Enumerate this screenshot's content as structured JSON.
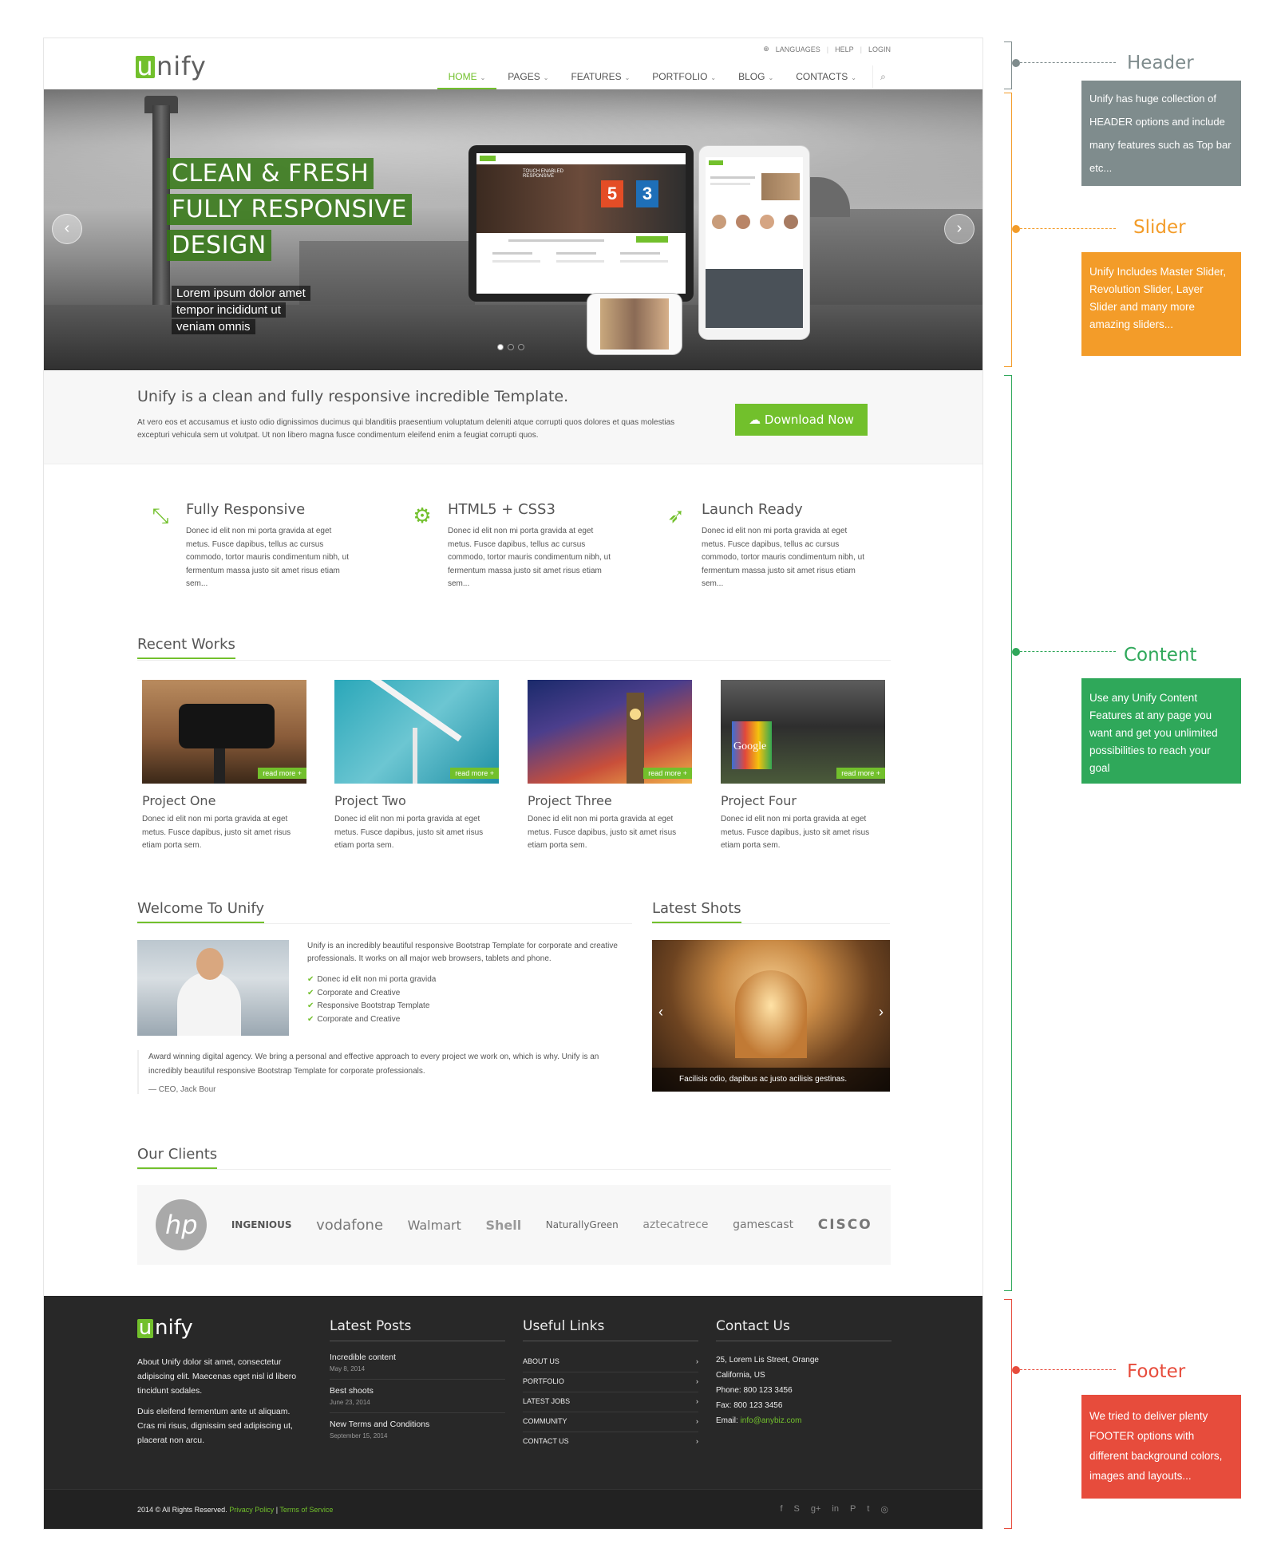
{
  "header": {
    "logo_letter": "u",
    "logo_rest": "nify",
    "topbar": {
      "languages": "LANGUAGES",
      "help": "HELP",
      "login": "LOGIN"
    },
    "nav": [
      "HOME",
      "PAGES",
      "FEATURES",
      "PORTFOLIO",
      "BLOG",
      "CONTACTS"
    ],
    "active_nav": "HOME"
  },
  "slider": {
    "captions": [
      "CLEAN & FRESH",
      "FULLY RESPONSIVE",
      "DESIGN"
    ],
    "sub_lines": [
      "Lorem ipsum dolor amet",
      "tempor incididunt ut",
      "veniam omnis"
    ],
    "laptop_badge": "TOUCH ENABLED RESPONSIVE",
    "active_dot": 1,
    "dot_count": 3
  },
  "promo": {
    "title": "Unify is a clean and fully responsive incredible Template.",
    "text": "At vero eos et accusamus et iusto odio dignissimos ducimus qui blanditiis praesentium voluptatum deleniti atque corrupti quos dolores et quas molestias excepturi vehicula sem ut volutpat. Ut non libero magna fusce condimentum eleifend enim a feugiat corrupti quos.",
    "button": "Download Now"
  },
  "features": [
    {
      "icon": "arrows-expand-icon",
      "title": "Fully Responsive",
      "text": "Donec id elit non mi porta gravida at eget metus. Fusce dapibus, tellus ac cursus commodo, tortor mauris condimentum nibh, ut fermentum massa justo sit amet risus etiam sem..."
    },
    {
      "icon": "gears-icon",
      "title": "HTML5 + CSS3",
      "text": "Donec id elit non mi porta gravida at eget metus. Fusce dapibus, tellus ac cursus commodo, tortor mauris condimentum nibh, ut fermentum massa justo sit amet risus etiam sem..."
    },
    {
      "icon": "rocket-icon",
      "title": "Launch Ready",
      "text": "Donec id elit non mi porta gravida at eget metus. Fusce dapibus, tellus ac cursus commodo, tortor mauris condimentum nibh, ut fermentum massa justo sit amet risus etiam sem..."
    }
  ],
  "recent_works": {
    "heading": "Recent Works",
    "read_more": "read more +",
    "items": [
      {
        "title": "Project One",
        "text": "Donec id elit non mi porta gravida at eget metus. Fusce dapibus, justo sit amet risus etiam porta sem."
      },
      {
        "title": "Project Two",
        "text": "Donec id elit non mi porta gravida at eget metus. Fusce dapibus, justo sit amet risus etiam porta sem."
      },
      {
        "title": "Project Three",
        "text": "Donec id elit non mi porta gravida at eget metus. Fusce dapibus, justo sit amet risus etiam porta sem."
      },
      {
        "title": "Project Four",
        "text": "Donec id elit non mi porta gravida at eget metus. Fusce dapibus, justo sit amet risus etiam porta sem."
      }
    ],
    "google_sign": "Google"
  },
  "welcome": {
    "heading": "Welcome To Unify",
    "text": "Unify is an incredibly beautiful responsive Bootstrap Template for corporate and creative professionals. It works on all major web browsers, tablets and phone.",
    "checklist": [
      "Donec id elit non mi porta gravida",
      "Corporate and Creative",
      "Responsive Bootstrap Template",
      "Corporate and Creative"
    ],
    "quote": "Award winning digital agency. We bring a personal and effective approach to every project we work on, which is why. Unify is an incredibly beautiful responsive Bootstrap Template for corporate professionals.",
    "quote_author": "— CEO, Jack Bour"
  },
  "latest_shots": {
    "heading": "Latest Shots",
    "caption": "Facilisis odio, dapibus ac justo acilisis gestinas."
  },
  "clients": {
    "heading": "Our Clients",
    "items": [
      "hp",
      "INGENIOUS",
      "vodafone",
      "Walmart",
      "Shell",
      "NaturallyGreen",
      "aztecatrece",
      "gamescast",
      "CISCO"
    ]
  },
  "footer": {
    "logo_letter": "u",
    "logo_rest": "nify",
    "about1": "About Unify dolor sit amet, consectetur adipiscing elit. Maecenas eget nisl id libero tincidunt sodales.",
    "about2": "Duis eleifend fermentum ante ut aliquam. Cras mi risus, dignissim sed adipiscing ut, placerat non arcu.",
    "latest_posts": {
      "heading": "Latest Posts",
      "items": [
        {
          "title": "Incredible content",
          "date": "May 8, 2014"
        },
        {
          "title": "Best shoots",
          "date": "June 23, 2014"
        },
        {
          "title": "New Terms and Conditions",
          "date": "September 15, 2014"
        }
      ]
    },
    "useful_links": {
      "heading": "Useful Links",
      "items": [
        "ABOUT US",
        "PORTFOLIO",
        "LATEST JOBS",
        "COMMUNITY",
        "CONTACT US"
      ]
    },
    "contact": {
      "heading": "Contact Us",
      "address1": "25, Lorem Lis Street, Orange",
      "address2": "California, US",
      "phone": "Phone: 800 123 3456",
      "fax": "Fax: 800 123 3456",
      "email_label": "Email:",
      "email": "info@anybiz.com"
    },
    "copyright": "2014 © All Rights Reserved.",
    "privacy": "Privacy Policy",
    "terms": "Terms of Service",
    "social": [
      "facebook-icon",
      "skype-icon",
      "google-plus-icon",
      "linkedin-icon",
      "pinterest-icon",
      "twitter-icon",
      "dribbble-icon"
    ]
  },
  "annotations": [
    {
      "title": "Header",
      "text": "Unify has huge collection of HEADER options and include many features such as Top bar etc...",
      "color": "#7f8c8d"
    },
    {
      "title": "Slider",
      "text": "Unify Includes Master Slider, Revolution Slider, Layer Slider and many more amazing sliders...",
      "color": "#f39c29"
    },
    {
      "title": "Content",
      "text": "Use any Unify Content Features at any page you want and get you unlimited possibilities to reach your goal",
      "color": "#2fa85a"
    },
    {
      "title": "Footer",
      "text": "We tried to deliver plenty FOOTER options with different background colors, images and layouts...",
      "color": "#e74c3c"
    }
  ],
  "colors": {
    "accent": "#72c02c",
    "footer_bg": "#282828"
  }
}
